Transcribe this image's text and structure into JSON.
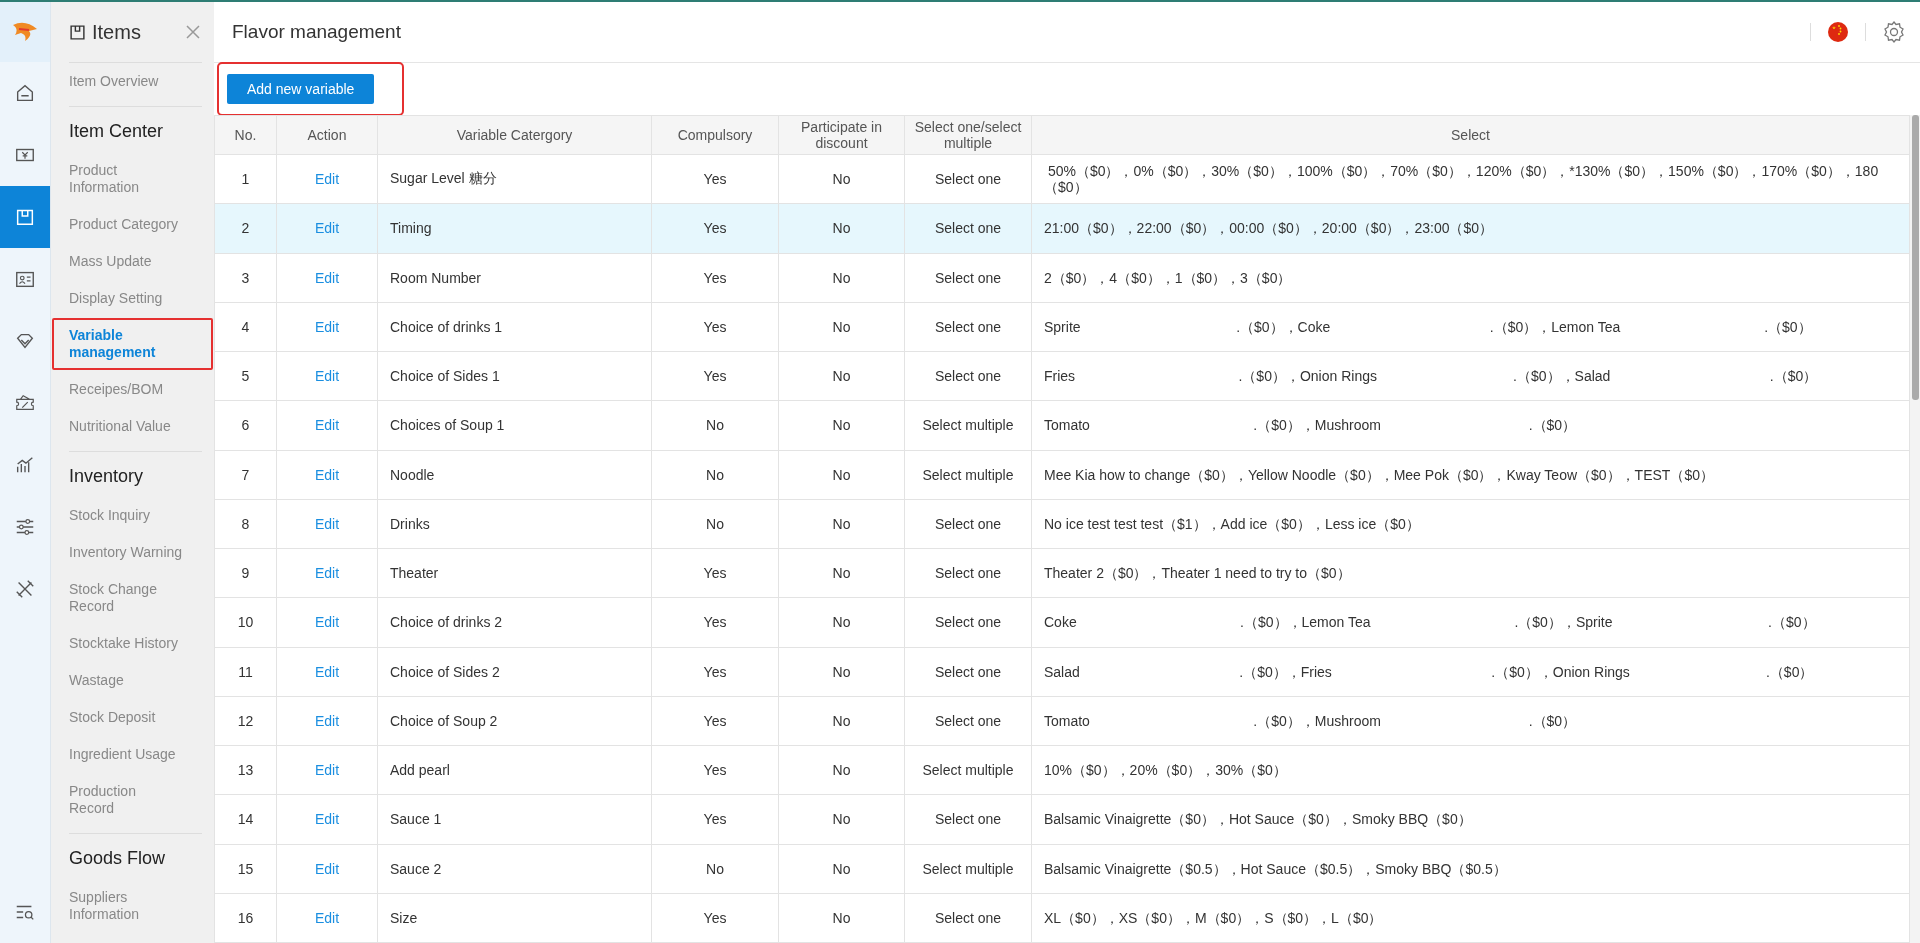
{
  "rail": {
    "items": [
      {
        "kind": "home",
        "selected": false
      },
      {
        "kind": "cash",
        "selected": false
      },
      {
        "kind": "box",
        "selected": true
      },
      {
        "kind": "card",
        "selected": false
      },
      {
        "kind": "diamond",
        "selected": false
      },
      {
        "kind": "ticket",
        "selected": false
      },
      {
        "kind": "chart",
        "selected": false
      },
      {
        "kind": "sliders",
        "selected": false
      },
      {
        "kind": "tools",
        "selected": false
      }
    ]
  },
  "sidebar": {
    "title": "Items",
    "items": [
      {
        "kind": "link",
        "label": "Item Overview",
        "selected": false,
        "annotated": false
      },
      {
        "kind": "heading",
        "label": "Item Center"
      },
      {
        "kind": "link",
        "label": "Product Information",
        "selected": false,
        "annotated": false
      },
      {
        "kind": "link",
        "label": "Product Category",
        "selected": false,
        "annotated": false
      },
      {
        "kind": "link",
        "label": "Mass Update",
        "selected": false,
        "annotated": false
      },
      {
        "kind": "link",
        "label": "Display Setting",
        "selected": false,
        "annotated": false
      },
      {
        "kind": "link",
        "label": "Variable management",
        "selected": true,
        "annotated": true
      },
      {
        "kind": "link",
        "label": "Receipes/BOM",
        "selected": false,
        "annotated": false
      },
      {
        "kind": "link",
        "label": "Nutritional Value",
        "selected": false,
        "annotated": false
      },
      {
        "kind": "heading",
        "label": "Inventory"
      },
      {
        "kind": "link",
        "label": "Stock Inquiry",
        "selected": false,
        "annotated": false
      },
      {
        "kind": "link",
        "label": "Inventory Warning",
        "selected": false,
        "annotated": false
      },
      {
        "kind": "link",
        "label": "Stock Change Record",
        "selected": false,
        "annotated": false
      },
      {
        "kind": "link",
        "label": "Stocktake History",
        "selected": false,
        "annotated": false
      },
      {
        "kind": "link",
        "label": "Wastage",
        "selected": false,
        "annotated": false
      },
      {
        "kind": "link",
        "label": "Stock Deposit",
        "selected": false,
        "annotated": false
      },
      {
        "kind": "link",
        "label": "Ingredient Usage",
        "selected": false,
        "annotated": false
      },
      {
        "kind": "link",
        "label": "Production Record",
        "selected": false,
        "annotated": false
      },
      {
        "kind": "heading",
        "label": "Goods Flow"
      },
      {
        "kind": "link",
        "label": "Suppliers Information",
        "selected": false,
        "annotated": false
      }
    ]
  },
  "header": {
    "title": "Flavor management"
  },
  "toolbar": {
    "add_button": {
      "label": "Add new variable",
      "annotated": true
    }
  },
  "table": {
    "columns": [
      "No.",
      "Action",
      "Variable Catergory",
      "Compulsory",
      "Participate in discount",
      "Select one/select multiple",
      "Select"
    ],
    "rows": [
      {
        "no": "1",
        "action": "Edit",
        "category": "Sugar Level 糖分",
        "compulsory": "Yes",
        "discount": "No",
        "mode": "Select one",
        "select": " 50%（$0），0%（$0），30%（$0），100%（$0），70%（$0），120%（$0），*130%（$0），150%（$0），170%（$0），180（$0）",
        "selected": false
      },
      {
        "no": "2",
        "action": "Edit",
        "category": "Timing",
        "compulsory": "Yes",
        "discount": "No",
        "mode": "Select one",
        "select": "21:00（$0），22:00（$0），00:00（$0），20:00（$0），23:00（$0）",
        "selected": true
      },
      {
        "no": "3",
        "action": "Edit",
        "category": "Room Number",
        "compulsory": "Yes",
        "discount": "No",
        "mode": "Select one",
        "select": "2（$0），4（$0），1（$0），3（$0）",
        "selected": false
      },
      {
        "no": "4",
        "action": "Edit",
        "category": "Choice of drinks 1",
        "compulsory": "Yes",
        "discount": "No",
        "mode": "Select one",
        "select": "Sprite                                        .（$0），Coke                                         .（$0），Lemon Tea                                     .（$0）",
        "selected": false
      },
      {
        "no": "5",
        "action": "Edit",
        "category": "Choice of Sides 1",
        "compulsory": "Yes",
        "discount": "No",
        "mode": "Select one",
        "select": "Fries                                          .（$0），Onion Rings                                   .（$0），Salad                                         .（$0）",
        "selected": false
      },
      {
        "no": "6",
        "action": "Edit",
        "category": "Choices of Soup 1",
        "compulsory": "No",
        "discount": "No",
        "mode": "Select multiple",
        "select": "Tomato                                          .（$0），Mushroom                                      .（$0）",
        "selected": false
      },
      {
        "no": "7",
        "action": "Edit",
        "category": "Noodle",
        "compulsory": "No",
        "discount": "No",
        "mode": "Select multiple",
        "select": "Mee Kia how to change（$0），Yellow Noodle（$0），Mee Pok（$0），Kway Teow（$0），TEST（$0）",
        "selected": false
      },
      {
        "no": "8",
        "action": "Edit",
        "category": "Drinks",
        "compulsory": "No",
        "discount": "No",
        "mode": "Select one",
        "select": "No ice test test test（$1），Add ice（$0），Less ice（$0）",
        "selected": false
      },
      {
        "no": "9",
        "action": "Edit",
        "category": "Theater",
        "compulsory": "Yes",
        "discount": "No",
        "mode": "Select one",
        "select": "Theater 2（$0），Theater 1 need to try to（$0）",
        "selected": false
      },
      {
        "no": "10",
        "action": "Edit",
        "category": "Choice of drinks 2",
        "compulsory": "Yes",
        "discount": "No",
        "mode": "Select one",
        "select": "Coke                                          .（$0），Lemon Tea                                     .（$0），Sprite                                        .（$0）",
        "selected": false
      },
      {
        "no": "11",
        "action": "Edit",
        "category": "Choice of Sides 2",
        "compulsory": "Yes",
        "discount": "No",
        "mode": "Select one",
        "select": "Salad                                         .（$0），Fries                                         .（$0），Onion Rings                                   .（$0）",
        "selected": false
      },
      {
        "no": "12",
        "action": "Edit",
        "category": "Choice of Soup 2",
        "compulsory": "Yes",
        "discount": "No",
        "mode": "Select one",
        "select": "Tomato                                          .（$0），Mushroom                                      .（$0）",
        "selected": false
      },
      {
        "no": "13",
        "action": "Edit",
        "category": "Add pearl",
        "compulsory": "Yes",
        "discount": "No",
        "mode": "Select multiple",
        "select": "10%（$0），20%（$0），30%（$0）",
        "selected": false
      },
      {
        "no": "14",
        "action": "Edit",
        "category": "Sauce 1",
        "compulsory": "Yes",
        "discount": "No",
        "mode": "Select one",
        "select": "Balsamic Vinaigrette（$0），Hot Sauce（$0），Smoky BBQ（$0）",
        "selected": false
      },
      {
        "no": "15",
        "action": "Edit",
        "category": "Sauce 2",
        "compulsory": "No",
        "discount": "No",
        "mode": "Select multiple",
        "select": "Balsamic Vinaigrette（$0.5），Hot Sauce（$0.5），Smoky BBQ（$0.5）",
        "selected": false
      },
      {
        "no": "16",
        "action": "Edit",
        "category": "Size",
        "compulsory": "Yes",
        "discount": "No",
        "mode": "Select one",
        "select": "XL（$0），XS（$0），M（$0），S（$0），L（$0）",
        "selected": false
      }
    ]
  }
}
